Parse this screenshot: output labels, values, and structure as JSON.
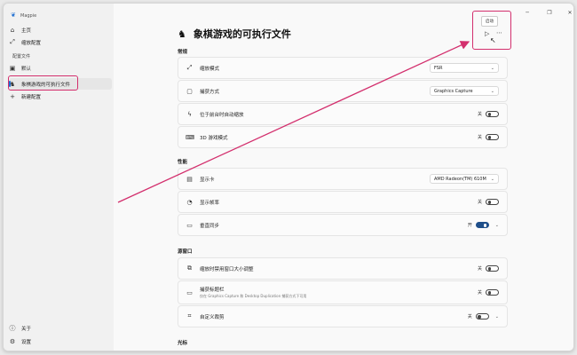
{
  "app": {
    "name": "Magpie"
  },
  "sidebar": {
    "home": "主页",
    "scaling_config": "缩放配置",
    "profiles_header": "配置文件",
    "default": "默认",
    "current_profile": "象棋游戏的可执行文件",
    "new_profile": "新建配置",
    "about": "关于",
    "settings": "设置"
  },
  "page": {
    "title": "象棋游戏的可执行文件"
  },
  "toolbar": {
    "tooltip": "启动"
  },
  "sections": {
    "general": "常规",
    "performance": "性能",
    "source_window": "源窗口",
    "cursor": "光标"
  },
  "settings": {
    "scale_mode": {
      "label": "缩放模式",
      "value": "FSR"
    },
    "capture_method": {
      "label": "捕获方式",
      "value": "Graphics Capture"
    },
    "auto_scale": {
      "label": "位于前台时自动缩放",
      "state": "关"
    },
    "game_mode_3d": {
      "label": "3D 游戏模式",
      "state": "关"
    },
    "gpu": {
      "label": "显示卡",
      "value": "AMD Radeon(TM) 610M"
    },
    "show_fps": {
      "label": "显示帧率",
      "state": "关"
    },
    "vsync": {
      "label": "垂直同步",
      "state": "开"
    },
    "disable_resize": {
      "label": "缩放时禁用窗口大小调整",
      "state": "关"
    },
    "capture_titlebar": {
      "label": "捕获标题栏",
      "sub": "仅在 Graphics Capture 和 Desktop Duplication 捕获方式下可用",
      "state": "关"
    },
    "custom_crop": {
      "label": "自定义裁剪",
      "state": "关"
    }
  },
  "colors": {
    "accent": "#1f6fd1",
    "annotation": "#d32f6d",
    "toggle_on": "#1f4f8a"
  }
}
